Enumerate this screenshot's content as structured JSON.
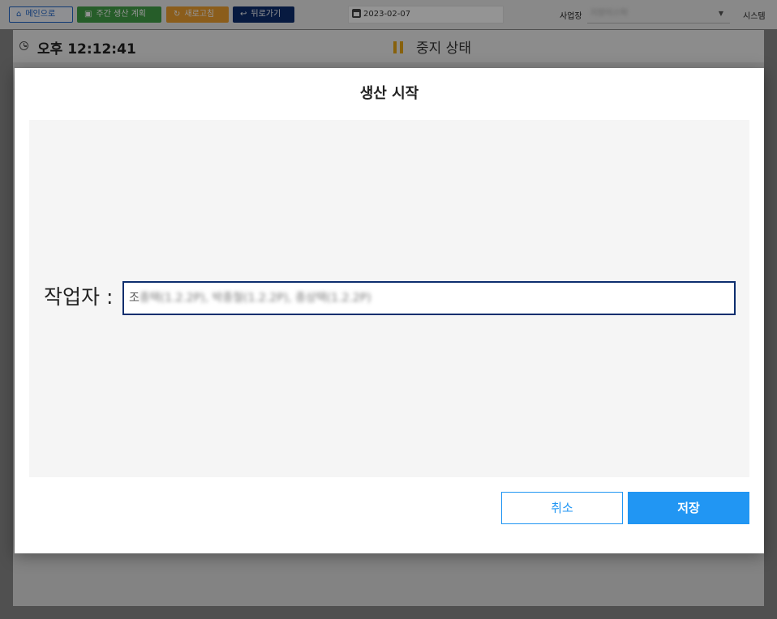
{
  "toolbar": {
    "main_label": "메인으로",
    "weekly_plan_label": "주간 생산 계획",
    "refresh_label": "새로고침",
    "back_label": "뒤로가기",
    "date_value": "2023-02-07",
    "site_label": "사업장",
    "site_value": "지방이스탁",
    "system_label": "시스템"
  },
  "status": {
    "time_text": "오후 12:12:41",
    "state_text": "중지 상태"
  },
  "modal": {
    "title": "생산 시작",
    "worker_label": "작업자 :",
    "worker_value_first": "조",
    "worker_value_rest": "종택(1.2.2P), 박종철(1.2.2P), 종상택(1.2.2P)",
    "cancel_label": "취소",
    "save_label": "저장"
  },
  "icons": {
    "main": "home-icon",
    "weekly_plan": "calendar-icon",
    "refresh": "refresh-icon",
    "back": "return-arrow-icon",
    "date": "calendar-icon",
    "clock": "clock-icon",
    "state": "pause-icon"
  },
  "colors": {
    "primary": "#2196f3",
    "navy": "#0d2e6e",
    "green": "#43a047",
    "orange": "#f0a030",
    "pause": "#e8a817"
  }
}
